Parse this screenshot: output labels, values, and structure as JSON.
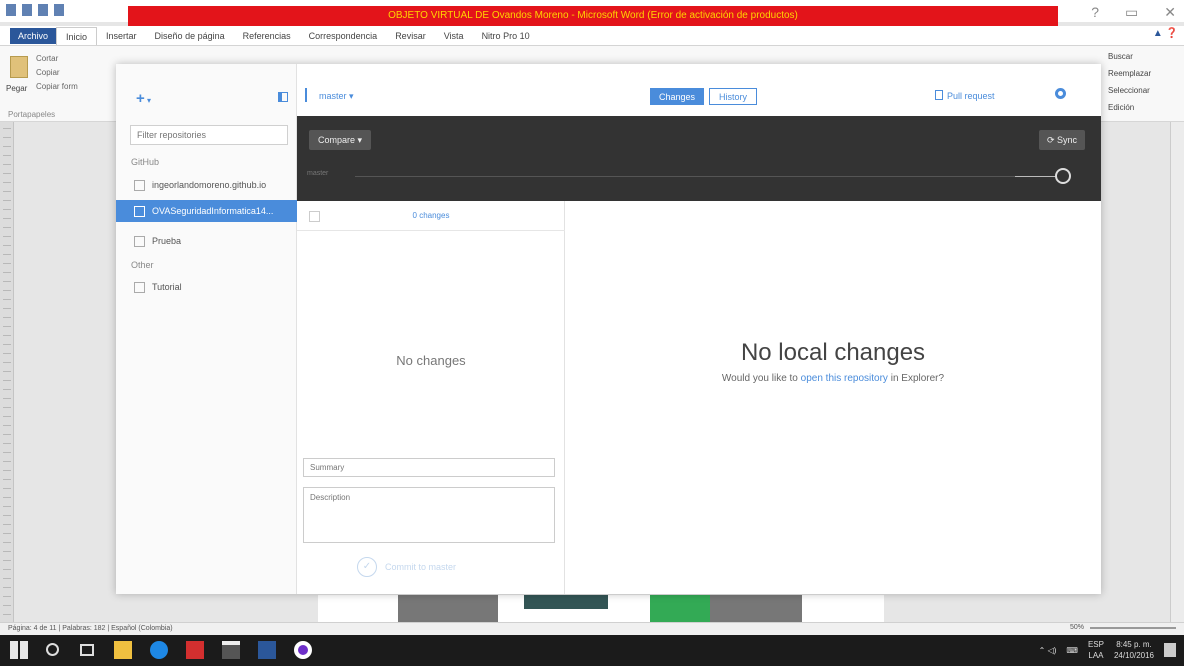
{
  "word": {
    "title": "OBJETO VIRTUAL DE Ovandos Moreno - Microsoft Word (Error de activación de productos)",
    "tabs": [
      "Archivo",
      "Inicio",
      "Insertar",
      "Diseño de página",
      "Referencias",
      "Correspondencia",
      "Revisar",
      "Vista",
      "Nitro Pro 10"
    ],
    "ribbon_left": {
      "paste": "Pegar",
      "cut": "Cortar",
      "copy": "Copiar",
      "format": "Copiar form",
      "group": "Portapapeles"
    },
    "ribbon_right": [
      "Buscar",
      "Reemplazar",
      "Seleccionar",
      "Edición"
    ],
    "status": "Página: 4 de 11  |  Palabras: 182  |  Español (Colombia)",
    "zoom": "50%"
  },
  "taskbar": {
    "lang": "ESP",
    "region": "LAA",
    "time": "8:45 p. m.",
    "date": "24/10/2016"
  },
  "sidebar": {
    "filter_placeholder": "Filter repositories",
    "github_heading": "GitHub",
    "github_items": [
      "ingeorlandomoreno.github.io",
      "OVASeguridadInformatica14...",
      "Prueba"
    ],
    "selected_index": 1,
    "other_heading": "Other",
    "other_items": [
      "Tutorial"
    ]
  },
  "topbar": {
    "branch": "master ▾",
    "tabs": {
      "changes": "Changes",
      "history": "History"
    },
    "pull_request": "Pull request"
  },
  "toolbar": {
    "compare": "Compare ▾",
    "sync": "Sync",
    "branch_track": "master"
  },
  "changes_panel": {
    "count": "0 changes",
    "empty": "No changes",
    "summary_placeholder": "Summary",
    "description_placeholder": "Description",
    "commit_label": "Commit to master"
  },
  "diff_panel": {
    "title": "No local changes",
    "sub_before": "Would you like to ",
    "sub_link": "open this repository",
    "sub_after": " in Explorer?"
  }
}
